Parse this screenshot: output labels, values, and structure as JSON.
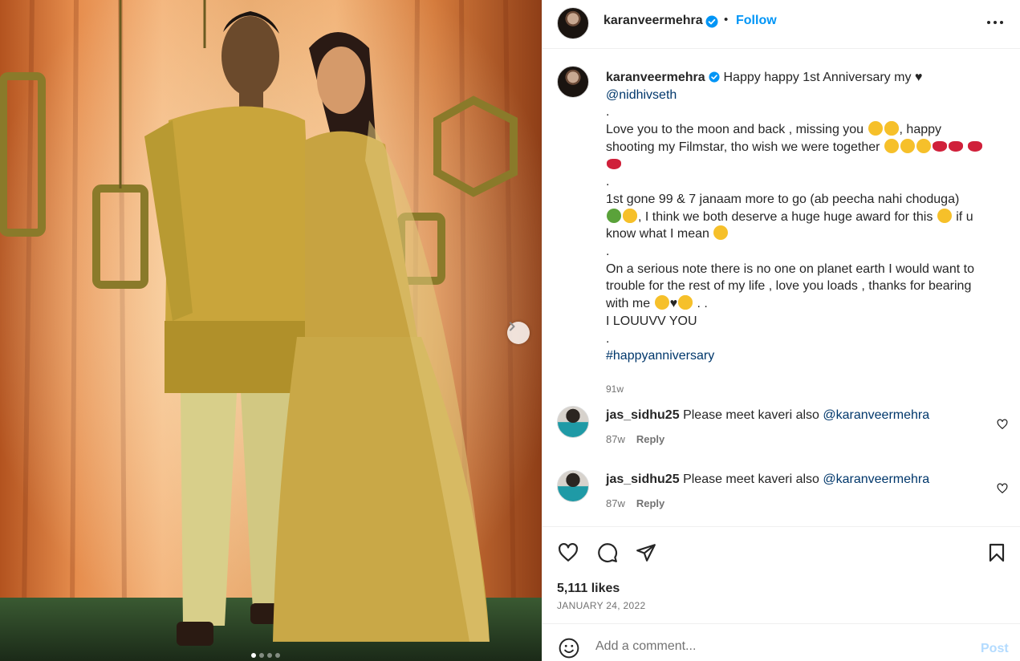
{
  "post": {
    "username": "karanveermehra",
    "follow_label": "Follow",
    "separator": "•"
  },
  "caption": {
    "username": "karanveermehra",
    "line1": "Happy happy 1st Anniversary my",
    "mention": "@nidhivseth",
    "dot": ".",
    "p1a": "Love you to the moon and back , missing you",
    "p1b": ", happy shooting my Filmstar, tho wish we were together",
    "p2a": "1st gone 99 & 7 janaam more to go (ab peecha nahi choduga)",
    "p2b": ", I think we both deserve a huge huge award for this",
    "p2c": "if u know what I mean",
    "p3a": "On a serious note there is no one on planet earth I would want to trouble for the rest of my life , love you loads , thanks for bearing with me",
    "p3b": ". .",
    "p3c": "I LOUUVV YOU",
    "hashtag": "#happyanniversary",
    "time": "91w"
  },
  "comments": [
    {
      "username": "jas_sidhu25",
      "text": "Please meet kaveri also",
      "mention": "@karanveermehra",
      "time": "87w",
      "reply": "Reply"
    },
    {
      "username": "jas_sidhu25",
      "text": "Please meet kaveri also",
      "mention": "@karanveermehra",
      "time": "87w",
      "reply": "Reply"
    }
  ],
  "likes": "5,111 likes",
  "date": "JANUARY 24, 2022",
  "comment_box": {
    "placeholder": "Add a comment...",
    "post_label": "Post"
  },
  "carousel": {
    "slides": 4,
    "current": 1
  },
  "colors": {
    "link": "#00376b",
    "follow": "#0095f6",
    "post_disabled": "#b3dbff",
    "muted": "#737373"
  },
  "icons": [
    "verified-icon",
    "more-icon",
    "heart-icon",
    "comment-icon",
    "share-icon",
    "save-icon",
    "emoji-icon",
    "chevron-right-icon"
  ]
}
